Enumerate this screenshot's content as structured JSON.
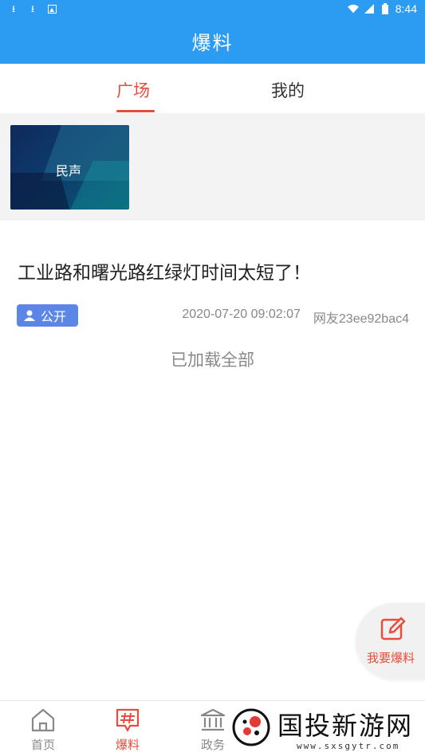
{
  "status_bar": {
    "time": "8:44",
    "left_icons": [
      "download-icon",
      "download-icon",
      "image-icon"
    ],
    "right_icons": [
      "wifi-icon",
      "signal-icon",
      "battery-icon"
    ]
  },
  "header": {
    "title": "爆料"
  },
  "tabs": [
    {
      "label": "广场",
      "active": true
    },
    {
      "label": "我的",
      "active": false
    }
  ],
  "banner": {
    "label": "民声"
  },
  "post": {
    "title": "工业路和曙光路红绿灯时间太短了！",
    "badge": "公开",
    "datetime": "2020-07-20 09:02:07",
    "author": "网友23ee92bac4"
  },
  "list_status": "已加载全部",
  "fab": {
    "label": "我要爆料",
    "icon": "edit-icon"
  },
  "bottom_nav": [
    {
      "label": "首页",
      "icon": "home-icon",
      "active": false
    },
    {
      "label": "爆料",
      "icon": "hashtag-icon",
      "active": true
    },
    {
      "label": "政务",
      "icon": "government-icon",
      "active": false
    }
  ],
  "watermark": {
    "text": "国投新游网",
    "url": "www.sxsgytr.com"
  },
  "colors": {
    "primary": "#2b9cf2",
    "accent": "#e74c3c",
    "badge": "#5b86e5"
  }
}
